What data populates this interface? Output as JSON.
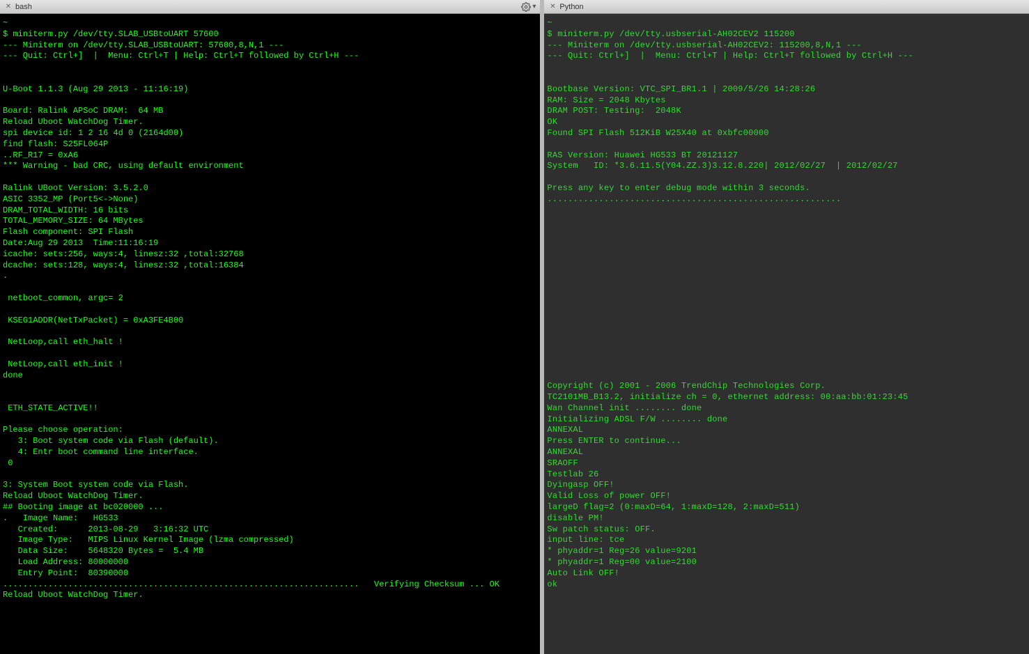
{
  "left_pane": {
    "tab_title": "bash",
    "lines": [
      "~",
      "$ miniterm.py /dev/tty.SLAB_USBtoUART 57600",
      "--- Miniterm on /dev/tty.SLAB_USBtoUART: 57600,8,N,1 ---",
      "--- Quit: Ctrl+]  |  Menu: Ctrl+T | Help: Ctrl+T followed by Ctrl+H ---",
      "",
      "",
      "U-Boot 1.1.3 (Aug 29 2013 - 11:16:19)",
      "",
      "Board: Ralink APSoC DRAM:  64 MB",
      "Reload Uboot WatchDog Timer.",
      "spi device id: 1 2 16 4d 0 (2164d00)",
      "find flash: S25FL064P",
      "..RF_R17 = 0xA6",
      "*** Warning - bad CRC, using default environment",
      "",
      "Ralink UBoot Version: 3.5.2.0",
      "ASIC 3352_MP (Port5<->None)",
      "DRAM_TOTAL_WIDTH: 16 bits",
      "TOTAL_MEMORY_SIZE: 64 MBytes",
      "Flash component: SPI Flash",
      "Date:Aug 29 2013  Time:11:16:19",
      "icache: sets:256, ways:4, linesz:32 ,total:32768",
      "dcache: sets:128, ways:4, linesz:32 ,total:16384",
      ".",
      "",
      " netboot_common, argc= 2",
      "",
      " KSEG1ADDR(NetTxPacket) = 0xA3FE4B00",
      "",
      " NetLoop,call eth_halt !",
      "",
      " NetLoop,call eth_init !",
      "done",
      "",
      "",
      " ETH_STATE_ACTIVE!!",
      "",
      "Please choose operation:",
      "   3: Boot system code via Flash (default).",
      "   4: Entr boot command line interface.",
      " 0",
      "",
      "3: System Boot system code via Flash.",
      "Reload Uboot WatchDog Timer.",
      "## Booting image at bc020000 ...",
      ".   Image Name:   HG533",
      "   Created:      2013-08-29   3:16:32 UTC",
      "   Image Type:   MIPS Linux Kernel Image (lzma compressed)",
      "   Data Size:    5648320 Bytes =  5.4 MB",
      "   Load Address: 80000000",
      "   Entry Point:  80390000",
      ".......................................................................   Verifying Checksum ... OK",
      "Reload Uboot WatchDog Timer."
    ]
  },
  "right_pane": {
    "tab_title": "Python",
    "lines": [
      "~",
      "$ miniterm.py /dev/tty.usbserial-AH02CEV2 115200",
      "--- Miniterm on /dev/tty.usbserial-AH02CEV2: 115200,8,N,1 ---",
      "--- Quit: Ctrl+]  |  Menu: Ctrl+T | Help: Ctrl+T followed by Ctrl+H ---",
      "",
      "",
      "Bootbase Version: VTC_SPI_BR1.1 | 2009/5/26 14:28:26",
      "RAM: Size = 2048 Kbytes",
      "DRAM POST: Testing:  2048K",
      "OK",
      "Found SPI Flash 512KiB W25X40 at 0xbfc00000",
      "",
      "RAS Version: Huawei HG533 BT 20121127",
      "System   ID: *3.6.11.5(Y04.ZZ.3)3.12.8.220| 2012/02/27  | 2012/02/27",
      "",
      "Press any key to enter debug mode within 3 seconds.",
      ".........................................................",
      "",
      "",
      "",
      "",
      "",
      "",
      "",
      "",
      "",
      "",
      "",
      "",
      "",
      "",
      "",
      "",
      "Copyright (c) 2001 - 2006 TrendChip Technologies Corp.",
      "TC2101MB_B13.2, initialize ch = 0, ethernet address: 00:aa:bb:01:23:45",
      "Wan Channel init ........ done",
      "Initializing ADSL F/W ........ done",
      "ANNEXAL",
      "Press ENTER to continue...",
      "ANNEXAL",
      "SRAOFF",
      "Testlab 26",
      "Dyingasp OFF!",
      "Valid Loss of power OFF!",
      "largeD flag=2 (0:maxD=64, 1:maxD=128, 2:maxD=511)",
      "disable PM!",
      "Sw patch status: OFF.",
      "input line: tce",
      "* phyaddr=1 Reg=26 value=9201",
      "* phyaddr=1 Reg=00 value=2100",
      "Auto Link OFF!",
      "ok"
    ]
  }
}
